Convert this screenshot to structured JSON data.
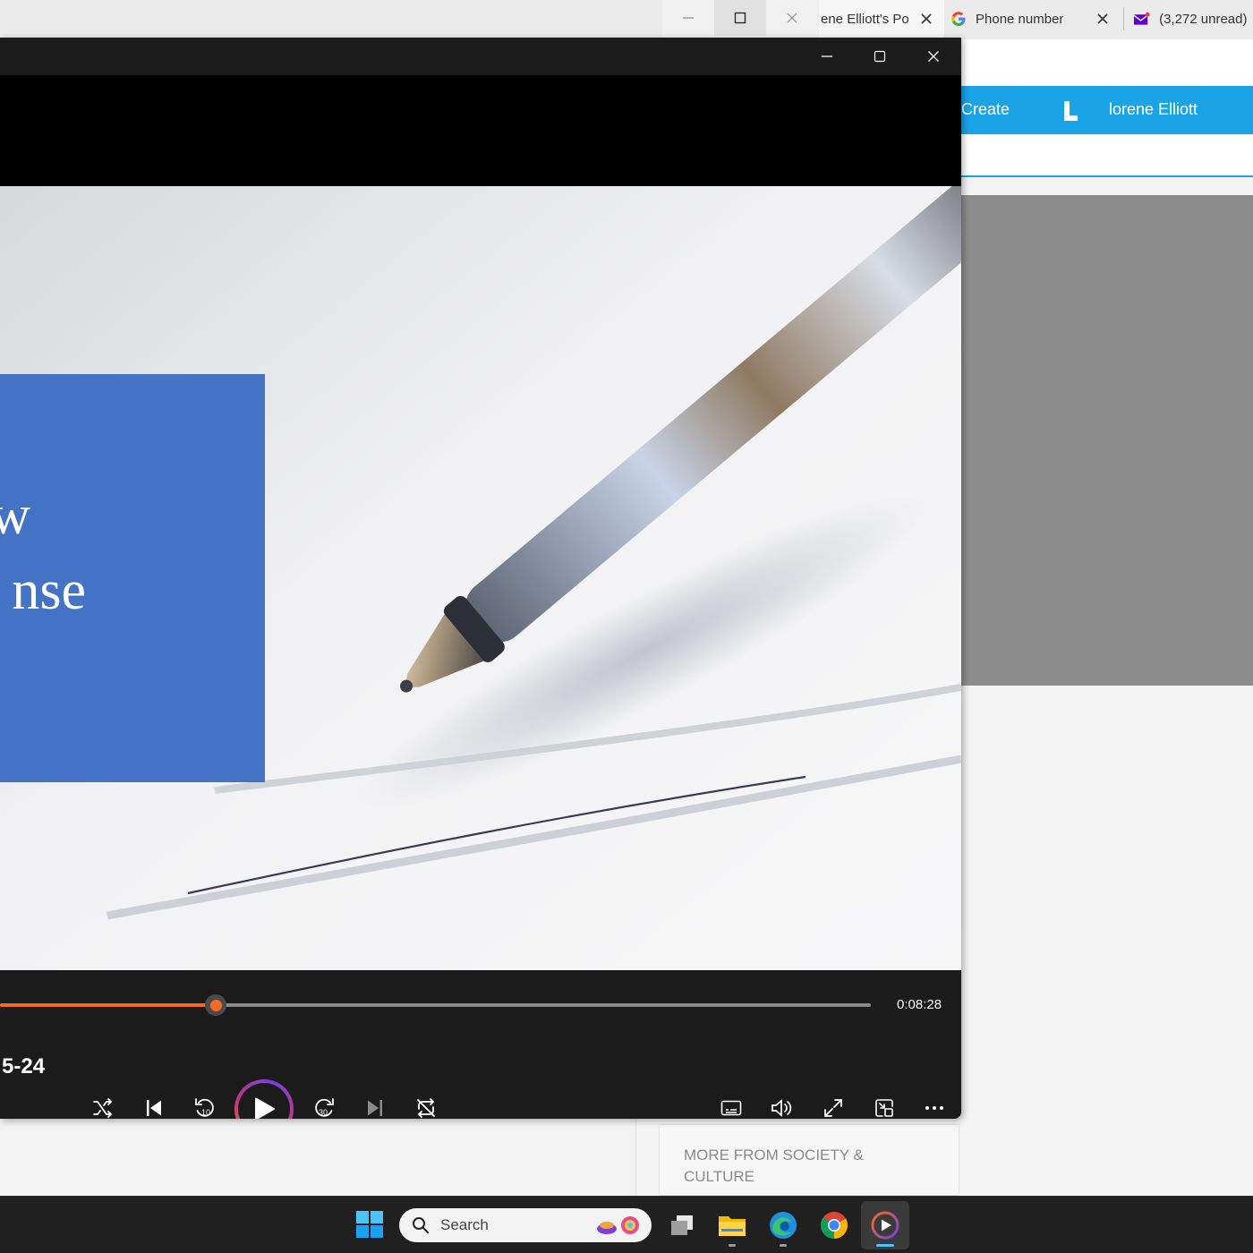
{
  "browser": {
    "tabs": [
      {
        "title": "ene Elliott's Po",
        "icon": "document-icon"
      },
      {
        "title": "Phone number",
        "icon": "google-icon"
      },
      {
        "title": "(3,272 unread)",
        "icon": "mail-icon"
      }
    ],
    "nav": {
      "create_label": "Create",
      "user_name": "lorene Elliott"
    },
    "more_card": "MORE FROM SOCIETY & CULTURE",
    "colors": {
      "nav_blue": "#1aa3e6",
      "gray_panel": "#8c8c8c"
    }
  },
  "player": {
    "video": {
      "title_lines": [
        "w",
        "nse"
      ]
    },
    "seek": {
      "progress_fraction": 0.248,
      "time_remaining": "0:08:28"
    },
    "episode_label": "5-24",
    "buttons": {
      "shuffle": "shuffle-icon",
      "previous": "previous-icon",
      "rewind": "rewind-10-icon",
      "rewind_label": "10",
      "play": "play-icon",
      "forward": "forward-30-icon",
      "forward_label": "30",
      "next": "next-icon",
      "repeat": "repeat-icon",
      "captions": "captions-icon",
      "volume": "volume-icon",
      "fullscreen": "fullscreen-icon",
      "miniplayer": "miniplayer-icon",
      "more": "more-icon"
    },
    "colors": {
      "accent": "#f26b21",
      "bar_bg": "#1b1b1b",
      "title_card": "#4472c4"
    }
  },
  "taskbar": {
    "search_placeholder": "Search",
    "apps": [
      "start-icon",
      "task-view-icon",
      "file-explorer-icon",
      "edge-icon",
      "chrome-icon",
      "media-player-icon"
    ]
  }
}
